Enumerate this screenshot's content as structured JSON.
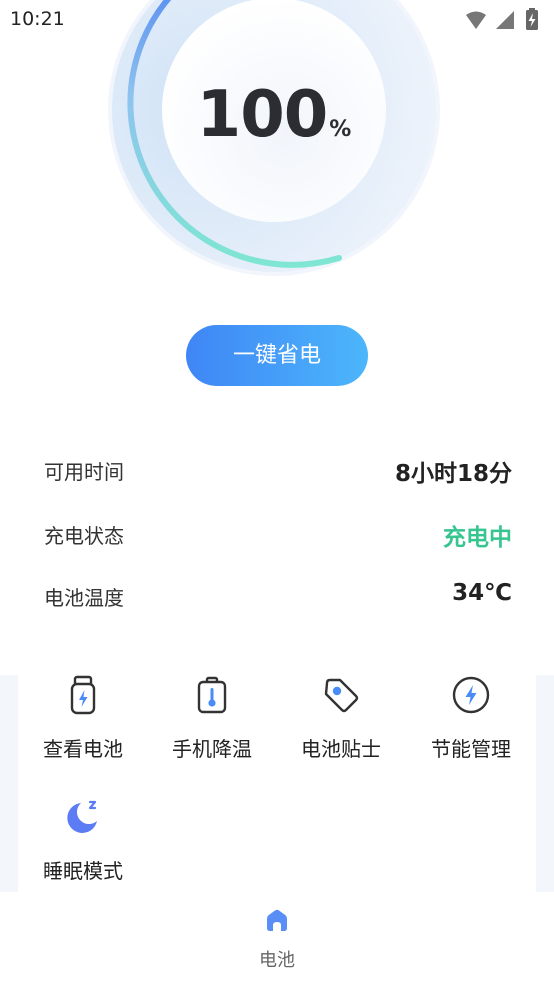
{
  "status_bar": {
    "time": "10:21",
    "icons": [
      "wifi-icon",
      "signal-icon",
      "battery-charging-icon"
    ]
  },
  "battery": {
    "level": 100,
    "value_text": "100",
    "unit": "%"
  },
  "save_button": {
    "label": "一键省电"
  },
  "info": {
    "available_time": {
      "label": "可用时间",
      "value": "8小时18分"
    },
    "charge_status": {
      "label": "充电状态",
      "value": "充电中"
    },
    "temperature": {
      "label": "电池温度",
      "value": "34℃"
    }
  },
  "tools": [
    {
      "label": "查看电池",
      "icon": "battery-view-icon"
    },
    {
      "label": "手机降温",
      "icon": "battery-thermometer-icon"
    },
    {
      "label": "电池贴士",
      "icon": "tag-icon"
    },
    {
      "label": "节能管理",
      "icon": "lightning-circle-icon"
    },
    {
      "label": "睡眠模式",
      "icon": "moon-sleep-icon"
    }
  ],
  "bottom_nav": {
    "items": [
      {
        "label": "电池",
        "icon": "home-icon",
        "active": true
      }
    ]
  },
  "colors": {
    "accent_blue": "#4a8cf7",
    "accent_cyan": "#4cb6fb",
    "charging_green": "#36c58f",
    "gauge_teal": "#7ee6d2",
    "panel_bg": "#f3f6fb",
    "text_dark": "#222222"
  }
}
